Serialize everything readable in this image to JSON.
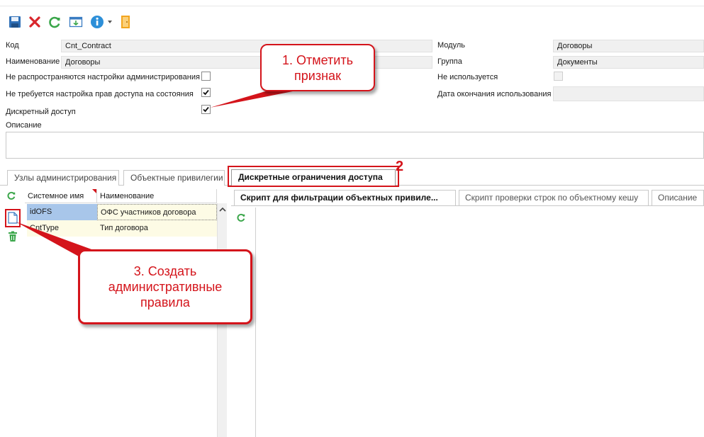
{
  "toolbar": {
    "buttons": [
      "save-icon",
      "delete-icon",
      "refresh-icon",
      "import-icon",
      "info-icon",
      "exit-door-icon"
    ],
    "colors": {
      "save": "#2e6fb6",
      "delete": "#d9262c",
      "refresh": "#3aa64a",
      "info": "#2d8fd8",
      "door": "#f2a51f"
    }
  },
  "form": {
    "code_label": "Код",
    "code_value": "Cnt_Contract",
    "name_label": "Наименование",
    "name_value": "Договоры",
    "no_admin_settings_label": "Не распространяются настройки администрирования",
    "no_state_rights_label": "Не требуется настройка прав доступа на состояния",
    "discrete_access_label": "Дискретный доступ",
    "description_label": "Описание",
    "module_label": "Модуль",
    "module_value": "Договоры",
    "group_label": "Группа",
    "group_value": "Документы",
    "not_used_label": "Не используется",
    "end_date_label": "Дата окончания использования",
    "end_date_value": ""
  },
  "tabs": [
    {
      "label": "Узлы администрирования"
    },
    {
      "label": "Объектные привилегии"
    },
    {
      "label": "Дискретные ограничения доступа",
      "active": true
    }
  ],
  "grid": {
    "columns": [
      "Системное имя",
      "Наименование"
    ],
    "rows": [
      {
        "system_name": "idOFS",
        "name": "ОФС участников договора",
        "selected": true
      },
      {
        "system_name": "CntType",
        "name": "Тип договора",
        "selected": false
      }
    ]
  },
  "subtabs": [
    {
      "label": "Скрипт для фильтрации объектных привиле...",
      "active": true
    },
    {
      "label": "Скрипт проверки строк по объектному кешу"
    },
    {
      "label": "Описание"
    }
  ],
  "callouts": {
    "c1_line1": "1. Отметить",
    "c1_line2": "признак",
    "c2_number": "2",
    "c3_line1": "3. Создать",
    "c3_line2": "административные",
    "c3_line3": "правила"
  },
  "accent_color": "#d4141b"
}
